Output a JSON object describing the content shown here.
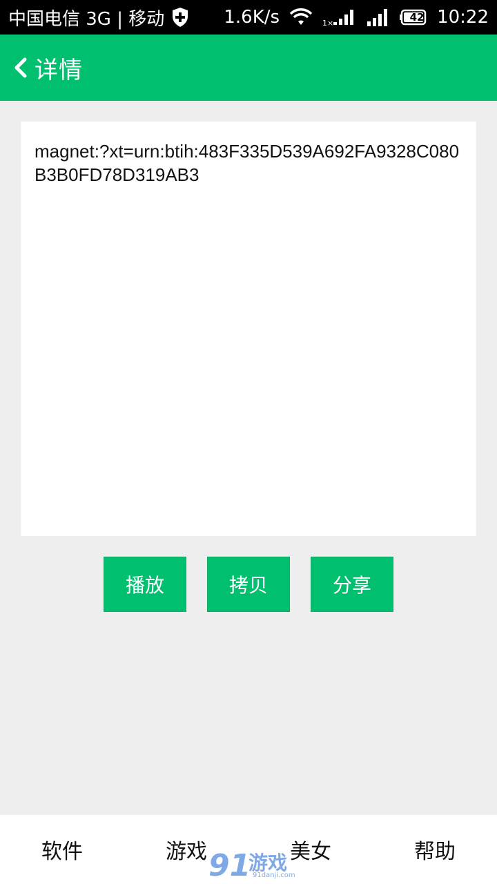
{
  "status_bar": {
    "carrier": "中国电信 3G | 移动",
    "speed": "1.6K/s",
    "battery": "42",
    "time": "10:22"
  },
  "app_bar": {
    "title": "详情"
  },
  "content": {
    "text": "magnet:?xt=urn:btih:483F335D539A692FA9328C080B3B0FD78D319AB3"
  },
  "actions": {
    "play": "播放",
    "copy": "拷贝",
    "share": "分享"
  },
  "bottom_nav": {
    "items": [
      "软件",
      "游戏",
      "美女",
      "帮助"
    ]
  },
  "watermark": {
    "text": "游戏",
    "subtext": "91danji.com"
  },
  "colors": {
    "primary": "#00bf6f",
    "background": "#eeeeee"
  }
}
